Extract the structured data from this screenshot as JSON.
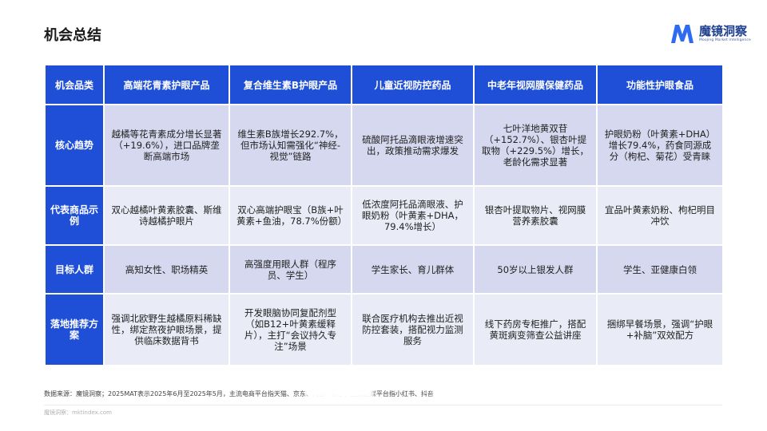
{
  "header": {
    "title": "机会总结",
    "logo_name": "魔镜洞察",
    "logo_tagline": "Moojing Market Intelligence",
    "logo_color": "#2e6bf0"
  },
  "table": {
    "corner_label": "机会品类",
    "columns": [
      "高端花青素护眼产品",
      "复合维生素B护眼产品",
      "儿童近视防控药品",
      "中老年视网膜保健药品",
      "功能性护眼食品"
    ],
    "rows": [
      {
        "label": "核心趋势",
        "cells": [
          "越橘等花青素成分增长显著（+19.6%），进口品牌垄断高端市场",
          "维生素B族增长292.7%，但市场认知需强化“神经-视觉”链路",
          "硫酸阿托品滴眼液增速突出，政策推动需求爆发",
          "七叶洋地黄双苷（+152.7%）、银杏叶提取物（+229.5%）增长，老龄化需求显著",
          "护眼奶粉（叶黄素+DHA）增长79.4%，药食同源成分（枸杞、菊花）受青睐"
        ]
      },
      {
        "label": "代表商品示例",
        "cells": [
          "双心越橘叶黄素胶囊、斯维诗越橘护眼片",
          "双心高端护眼宝（B族+叶黄素+鱼油，78.7%份额）",
          "低浓度阿托品滴眼液、护眼奶粉（叶黄素+DHA，79.4%增长）",
          "银杏叶提取物片、视网膜营养素胶囊",
          "宜品叶黄素奶粉、枸杞明目冲饮"
        ]
      },
      {
        "label": "目标人群",
        "cells": [
          "高知女性、职场精英",
          "高强度用眼人群（程序员、学生）",
          "学生家长、育儿群体",
          "50岁以上银发人群",
          "学生、亚健康白领"
        ]
      },
      {
        "label": "落地推荐方案",
        "cells": [
          "强调北欧野生越橘原料稀缺性，绑定熬夜护眼场景，提供临床数据背书",
          "开发眼脑协同复配剂型（如B12+叶黄素缓释片），主打“会议持久专注”场景",
          "联合医疗机构去推出近视防控套装，搭配视力监测服务",
          "线下药房专柜推广，搭配黄斑病变筛查公益讲座",
          "捆绑早餐场景，强调“护眼+补脑”双效配方"
        ]
      }
    ]
  },
  "footer": {
    "source": "数据来源：魔镜洞察；2025MAT表示2025年6月至2025年5月，主流电商平台指天猫、京东、抖音、快手，主流社媒平台指小红书、抖音",
    "site": "魔镜洞察：mktindex.com"
  }
}
